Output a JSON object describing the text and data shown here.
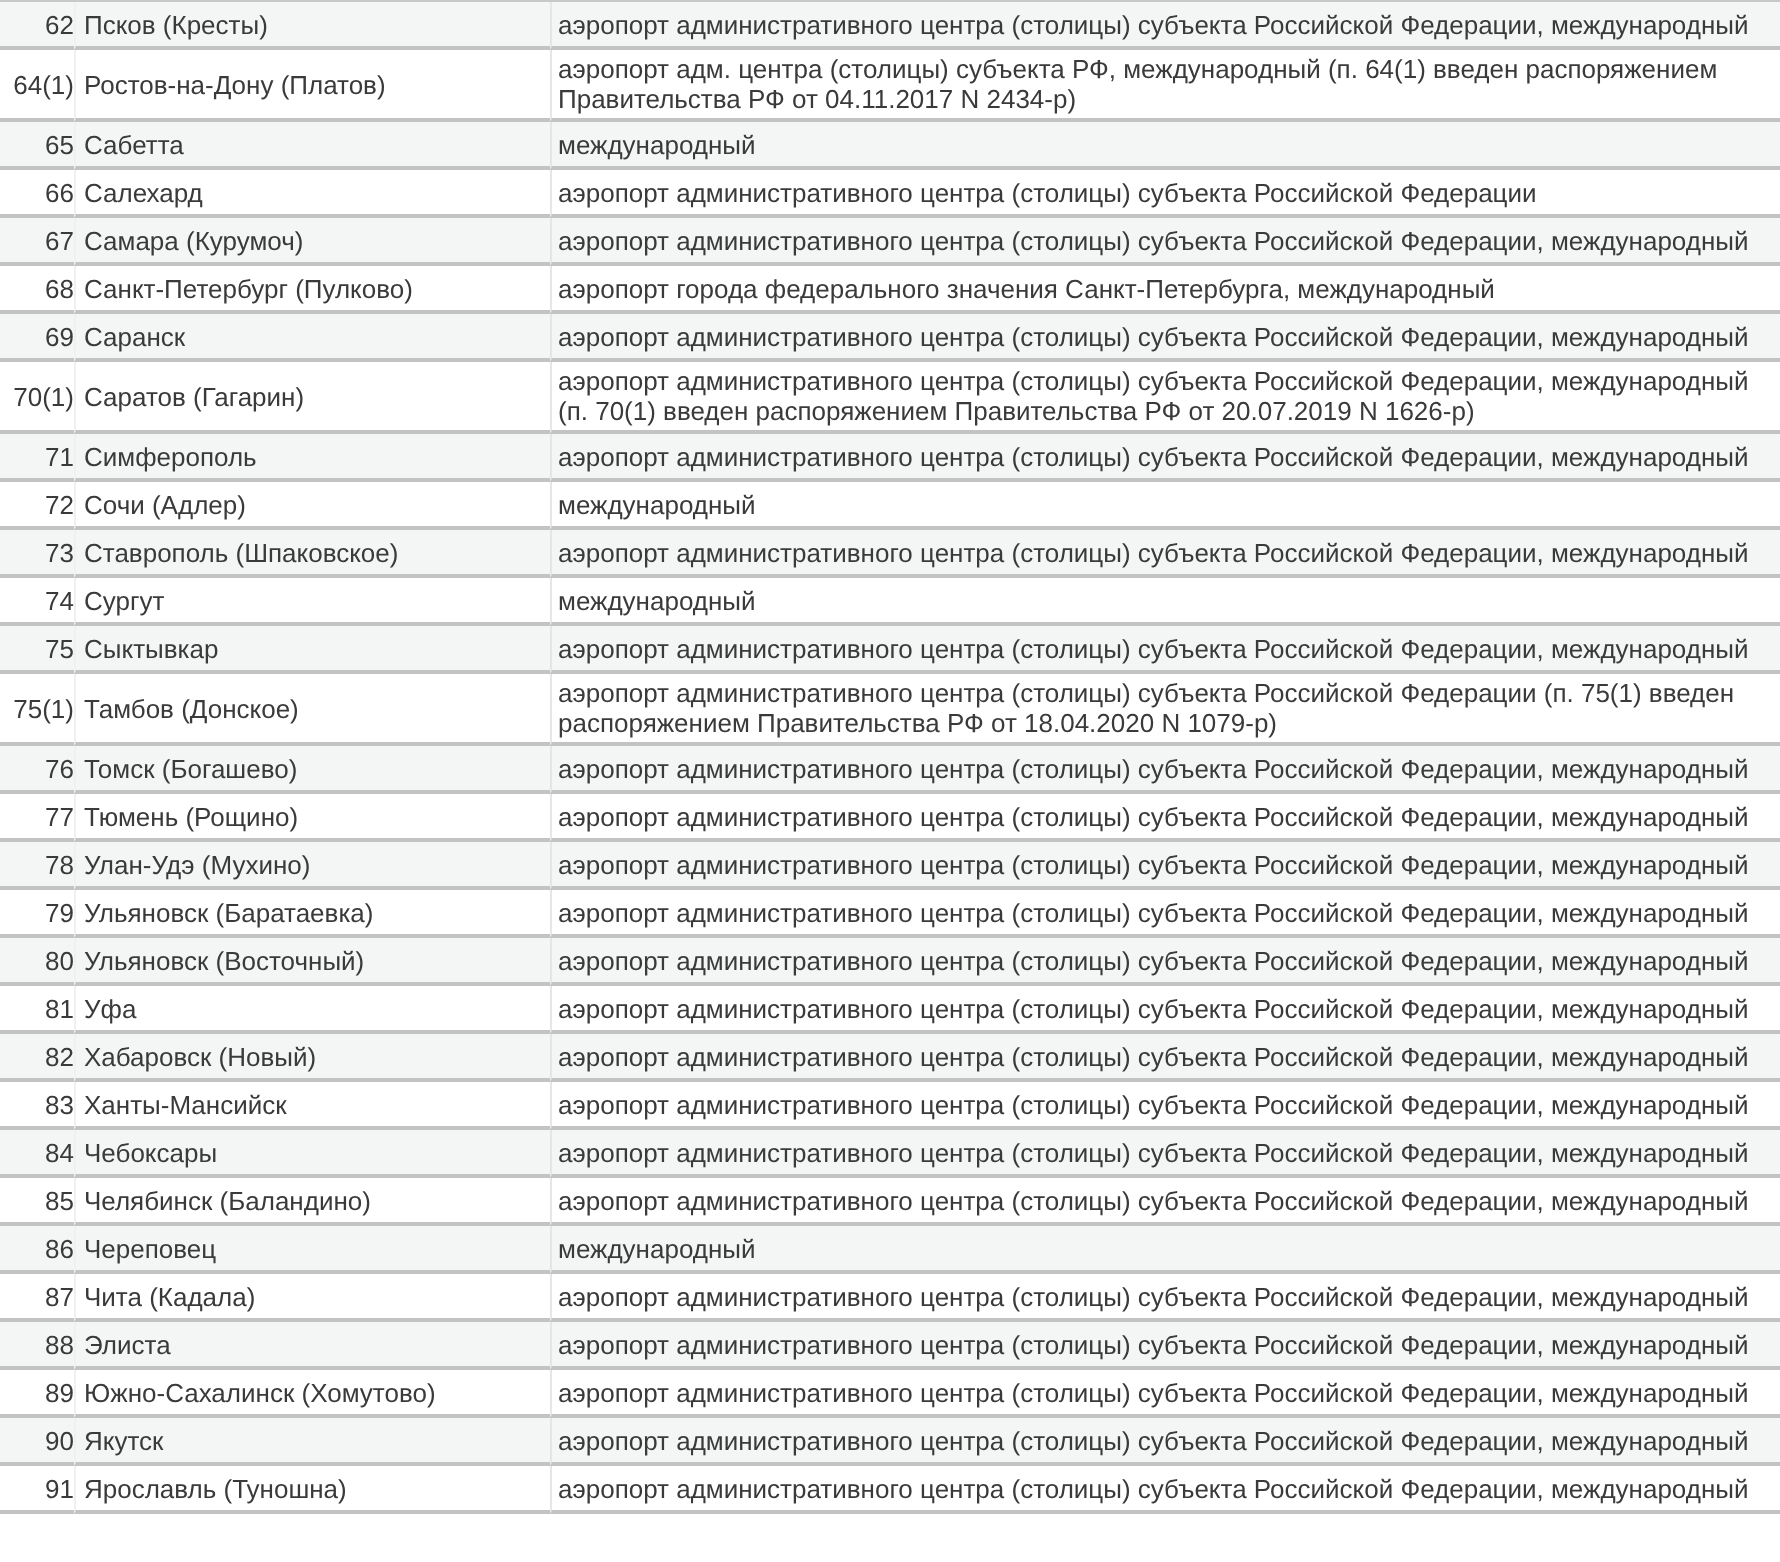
{
  "table": {
    "rows": [
      {
        "number": "62",
        "airport": "Псков (Кресты)",
        "status": "аэропорт административного центра (столицы) субъекта Российской Федерации, международный"
      },
      {
        "number": "64(1)",
        "airport": "Ростов-на-Дону (Платов)",
        "status": "аэропорт адм. центра (столицы) субъекта РФ, международный (п. 64(1) введен распоряжением Правительства РФ от 04.11.2017 N 2434-р)"
      },
      {
        "number": "65",
        "airport": "Сабетта",
        "status": "международный"
      },
      {
        "number": "66",
        "airport": "Салехард",
        "status": "аэропорт административного центра (столицы) субъекта Российской Федерации"
      },
      {
        "number": "67",
        "airport": "Самара (Курумоч)",
        "status": "аэропорт административного центра (столицы) субъекта Российской Федерации, международный"
      },
      {
        "number": "68",
        "airport": "Санкт-Петербург (Пулково)",
        "status": "аэропорт города федерального значения Санкт-Петербурга, международный"
      },
      {
        "number": "69",
        "airport": "Саранск",
        "status": "аэропорт административного центра (столицы) субъекта Российской Федерации, международный"
      },
      {
        "number": "70(1)",
        "airport": "Саратов (Гагарин)",
        "status": "аэропорт административного центра (столицы) субъекта Российской Федерации, международный (п. 70(1) введен распоряжением Правительства РФ от 20.07.2019 N 1626-р)"
      },
      {
        "number": "71",
        "airport": "Симферополь",
        "status": "аэропорт административного центра (столицы) субъекта Российской Федерации, международный"
      },
      {
        "number": "72",
        "airport": "Сочи (Адлер)",
        "status": "международный"
      },
      {
        "number": "73",
        "airport": "Ставрополь (Шпаковское)",
        "status": "аэропорт административного центра (столицы) субъекта Российской Федерации, международный"
      },
      {
        "number": "74",
        "airport": "Сургут",
        "status": "международный"
      },
      {
        "number": "75",
        "airport": "Сыктывкар",
        "status": "аэропорт административного центра (столицы) субъекта Российской Федерации, международный"
      },
      {
        "number": "75(1)",
        "airport": "Тамбов (Донское)",
        "status": "аэропорт административного центра (столицы) субъекта Российской Федерации (п. 75(1) введен распоряжением Правительства РФ от 18.04.2020 N 1079-р)"
      },
      {
        "number": "76",
        "airport": "Томск (Богашево)",
        "status": "аэропорт административного центра (столицы) субъекта Российской Федерации, международный"
      },
      {
        "number": "77",
        "airport": "Тюмень (Рощино)",
        "status": "аэропорт административного центра (столицы) субъекта Российской Федерации, международный"
      },
      {
        "number": "78",
        "airport": "Улан-Удэ (Мухино)",
        "status": "аэропорт административного центра (столицы) субъекта Российской Федерации, международный"
      },
      {
        "number": "79",
        "airport": "Ульяновск (Баратаевка)",
        "status": "аэропорт административного центра (столицы) субъекта Российской Федерации, международный"
      },
      {
        "number": "80",
        "airport": "Ульяновск (Восточный)",
        "status": "аэропорт административного центра (столицы) субъекта Российской Федерации, международный"
      },
      {
        "number": "81",
        "airport": "Уфа",
        "status": "аэропорт административного центра (столицы) субъекта Российской Федерации, международный"
      },
      {
        "number": "82",
        "airport": "Хабаровск (Новый)",
        "status": "аэропорт административного центра (столицы) субъекта Российской Федерации, международный"
      },
      {
        "number": "83",
        "airport": "Ханты-Мансийск",
        "status": "аэропорт административного центра (столицы) субъекта Российской Федерации, международный"
      },
      {
        "number": "84",
        "airport": "Чебоксары",
        "status": "аэропорт административного центра (столицы) субъекта Российской Федерации, международный"
      },
      {
        "number": "85",
        "airport": "Челябинск (Баландино)",
        "status": "аэропорт административного центра (столицы) субъекта Российской Федерации, международный"
      },
      {
        "number": "86",
        "airport": "Череповец",
        "status": "международный"
      },
      {
        "number": "87",
        "airport": "Чита (Кадала)",
        "status": "аэропорт административного центра (столицы) субъекта Российской Федерации, международный"
      },
      {
        "number": "88",
        "airport": "Элиста",
        "status": "аэропорт административного центра (столицы) субъекта Российской Федерации, международный"
      },
      {
        "number": "89",
        "airport": "Южно-Сахалинск (Хомутово)",
        "status": "аэропорт административного центра (столицы) субъекта Российской Федерации, международный"
      },
      {
        "number": "90",
        "airport": "Якутск",
        "status": "аэропорт административного центра (столицы) субъекта Российской Федерации, международный"
      },
      {
        "number": "91",
        "airport": "Ярославль (Туношна)",
        "status": "аэропорт административного центра (столицы) субъекта Российской Федерации, международный"
      }
    ]
  }
}
